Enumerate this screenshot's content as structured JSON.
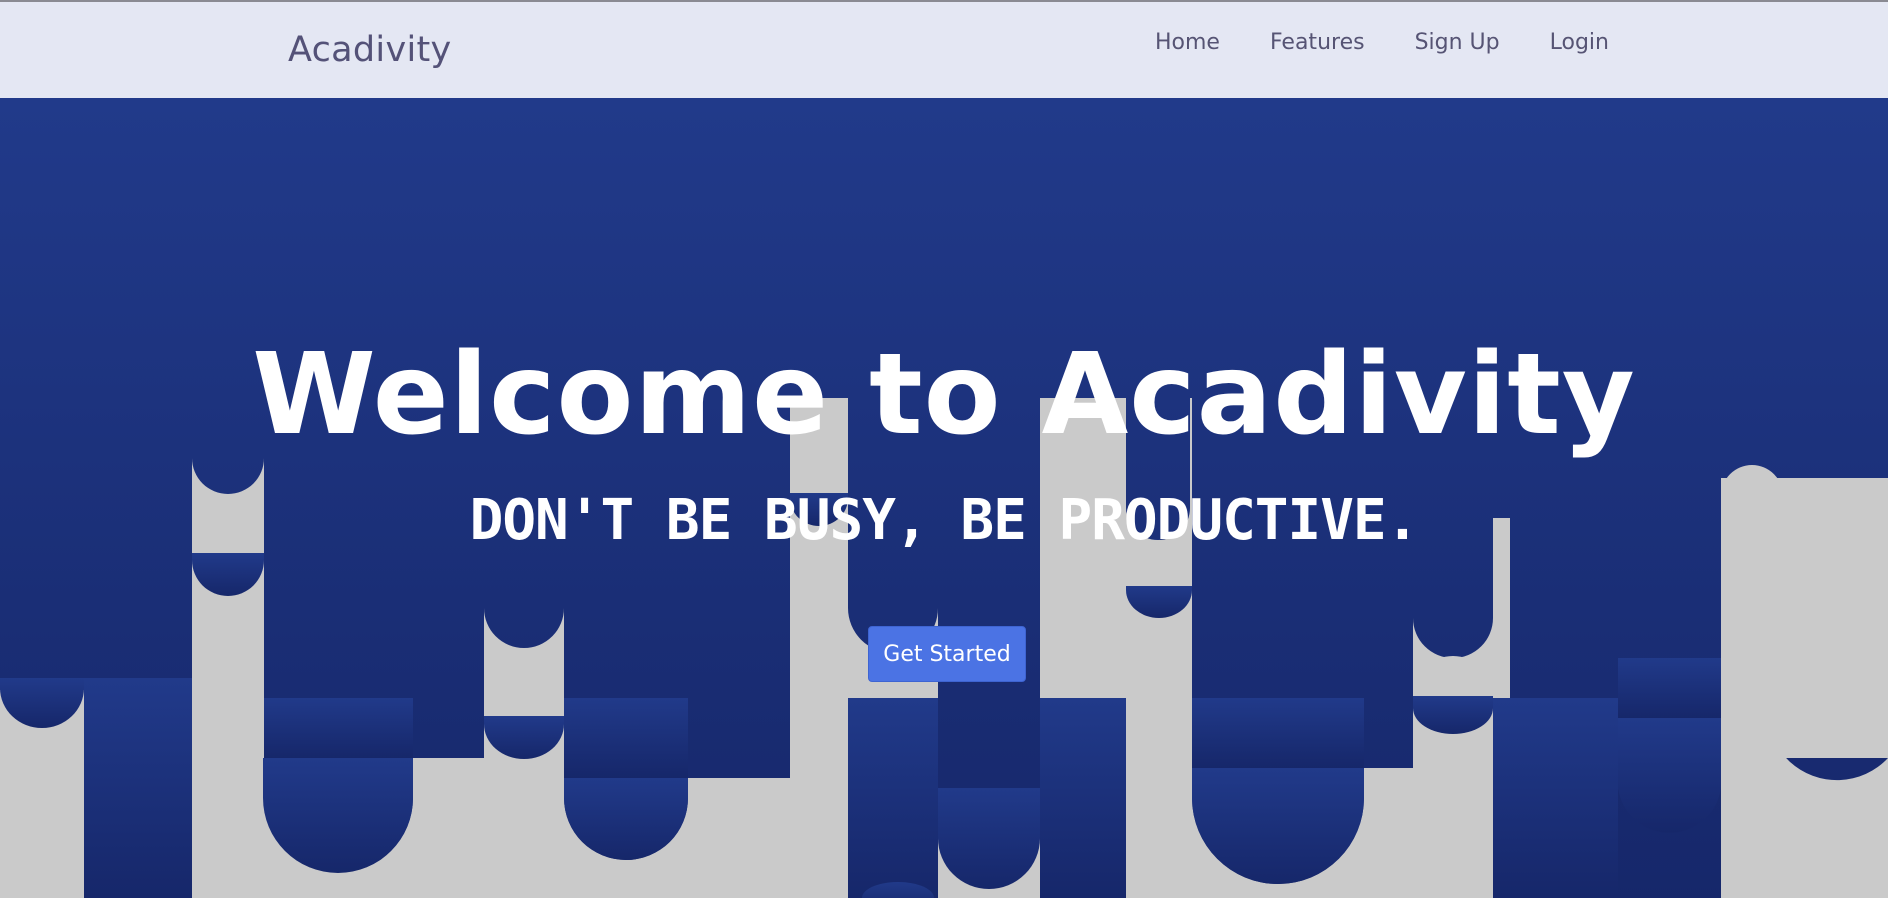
{
  "navbar": {
    "brand": "Acadivity",
    "links": [
      {
        "label": "Home"
      },
      {
        "label": "Features"
      },
      {
        "label": "Sign Up"
      },
      {
        "label": "Login"
      }
    ]
  },
  "hero": {
    "title": "Welcome to Acadivity",
    "tagline": "DON'T BE BUSY, BE PRODUCTIVE.",
    "cta_label": "Get Started"
  },
  "colors": {
    "navbar_bg": "#e4e7f3",
    "hero_top": "#213a8a",
    "hero_bottom": "#16276a",
    "drip_bg": "#cacaca",
    "button": "#4b73e4"
  }
}
